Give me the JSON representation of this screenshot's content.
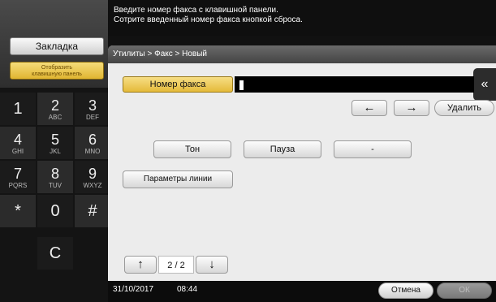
{
  "message": {
    "line1": "Введите номер факса с клавишной панели.",
    "line2": "Сотрите введенный номер факса кнопкой сброса."
  },
  "left_panel": {
    "bookmark_label": "Закладка",
    "keypad_toggle_line1": "Отобразить",
    "keypad_toggle_line2": "клавишную панель"
  },
  "keypad": [
    {
      "digit": "1",
      "letters": ""
    },
    {
      "digit": "2",
      "letters": "ABC"
    },
    {
      "digit": "3",
      "letters": "DEF"
    },
    {
      "digit": "4",
      "letters": "GHI"
    },
    {
      "digit": "5",
      "letters": "JKL"
    },
    {
      "digit": "6",
      "letters": "MNO"
    },
    {
      "digit": "7",
      "letters": "PQRS"
    },
    {
      "digit": "8",
      "letters": "TUV"
    },
    {
      "digit": "9",
      "letters": "WXYZ"
    },
    {
      "digit": "*",
      "letters": ""
    },
    {
      "digit": "0",
      "letters": ""
    },
    {
      "digit": "#",
      "letters": ""
    },
    {
      "digit": "C",
      "letters": ""
    }
  ],
  "breadcrumb": "Утилиты > Факс > Новый",
  "back_icon": "«",
  "fax": {
    "label": "Номер факса",
    "value": ""
  },
  "controls": {
    "left_arrow": "←",
    "right_arrow": "→",
    "delete_label": "Удалить",
    "tone_label": "Тон",
    "pause_label": "Пауза",
    "dash_label": "-",
    "line_params_label": "Параметры линии"
  },
  "pager": {
    "up": "↑",
    "text": "2 / 2",
    "down": "↓"
  },
  "status": {
    "date": "31/10/2017",
    "time": "08:44",
    "cancel_label": "Отмена",
    "ok_label": "ОК"
  }
}
